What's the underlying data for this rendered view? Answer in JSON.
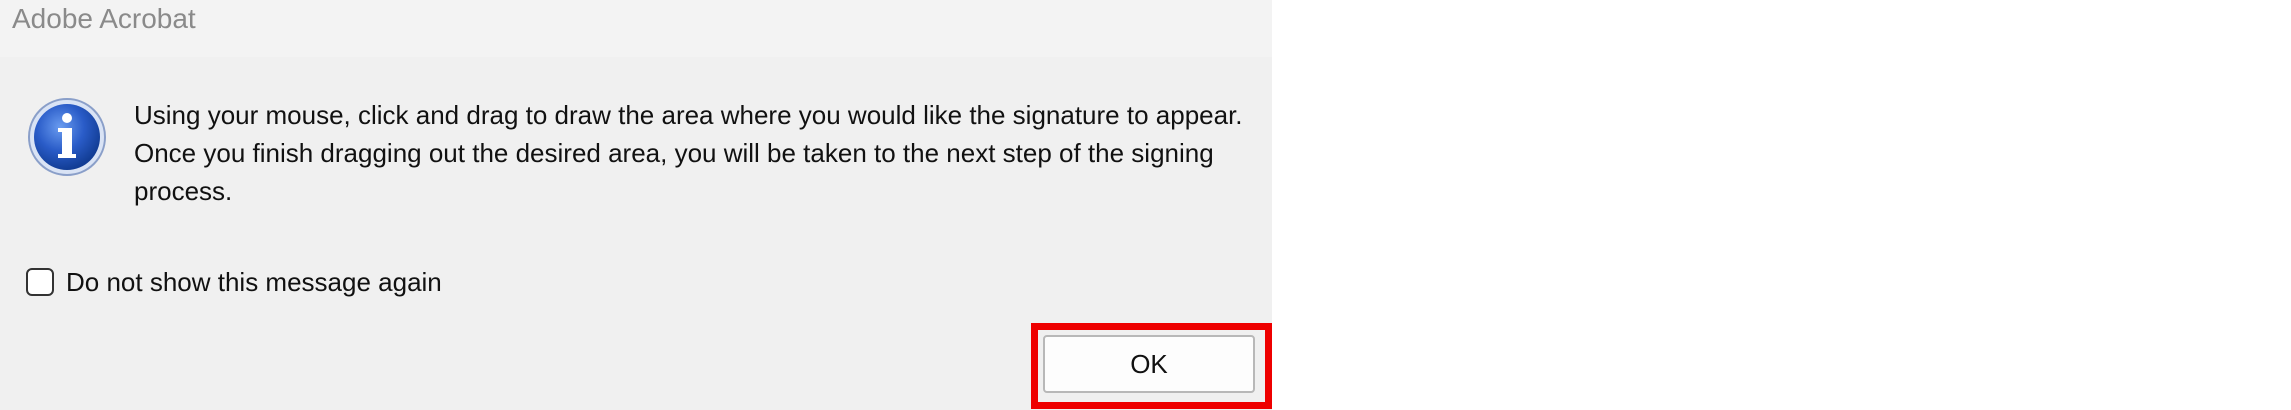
{
  "dialog": {
    "title": "Adobe Acrobat",
    "icon": "info-icon",
    "message": "Using your mouse, click and drag to draw the area where you would like the signature to appear. Once you finish dragging out the desired area, you will be taken to the next step of the signing process.",
    "checkbox": {
      "label": "Do not show this message again",
      "checked": false
    },
    "ok_label": "OK"
  },
  "colors": {
    "highlight": "#ee0000",
    "icon_blue": "#1a4fb0",
    "dialog_background": "#f0f0f0"
  }
}
